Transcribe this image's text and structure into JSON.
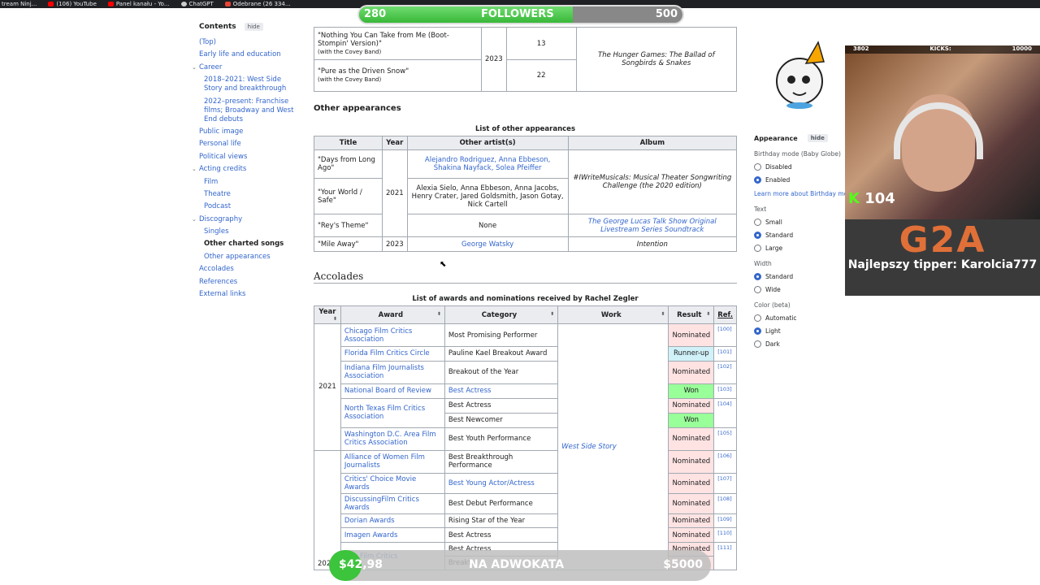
{
  "bookmarks": [
    "tream Ninj...",
    "(106) YouTube",
    "Panel kanału - Yo...",
    "ChatGPT",
    "Odebrane (26 334..."
  ],
  "followers": {
    "current": "280",
    "label": "FOLLOWERS",
    "goal": "500"
  },
  "toc": {
    "title": "Contents",
    "hide": "hide",
    "items": [
      {
        "label": "(Top)"
      },
      {
        "label": "Early life and education"
      },
      {
        "label": "Career",
        "chev": "v"
      },
      {
        "label": "2018–2021: West Side Story and breakthrough",
        "l2": true
      },
      {
        "label": "2022–present: Franchise films; Broadway and West End debuts",
        "l2": true
      },
      {
        "label": "Public image"
      },
      {
        "label": "Personal life"
      },
      {
        "label": "Political views"
      },
      {
        "label": "Acting credits",
        "chev": "v"
      },
      {
        "label": "Film",
        "l2": true
      },
      {
        "label": "Theatre",
        "l2": true
      },
      {
        "label": "Podcast",
        "l2": true
      },
      {
        "label": "Discography",
        "chev": "v"
      },
      {
        "label": "Singles",
        "l2": true
      },
      {
        "label": "Other charted songs",
        "l2": true,
        "current": true
      },
      {
        "label": "Other appearances",
        "l2": true
      },
      {
        "label": "Accolades"
      },
      {
        "label": "References"
      },
      {
        "label": "External links"
      }
    ]
  },
  "top_table": {
    "rows": [
      {
        "title": "\"Nothing You Can Take from Me (Boot-Stompin' Version)\"",
        "note": "(with the Covey Band)",
        "peak": "13"
      },
      {
        "title": "\"Pure as the Driven Snow\"",
        "note": "(with the Covey Band)",
        "peak": "22"
      }
    ],
    "year": "2023",
    "album": "The Hunger Games: The Ballad of Songbirds & Snakes"
  },
  "other": {
    "heading": "Other appearances",
    "caption": "List of other appearances",
    "headers": [
      "Title",
      "Year",
      "Other artist(s)",
      "Album"
    ],
    "rows": [
      {
        "title": "\"Days from Long Ago\"",
        "artists": "Alejandro Rodriguez, Anna Ebbeson, Shakina Nayfack, Solea Pfeiffer"
      },
      {
        "title": "\"Your World / Safe\"",
        "artists": "Alexia Sielo, Anna Ebbeson, Anna Jacobs, Henry Crater, Jared Goldsmith, Jason Gotay, Nick Cartell"
      },
      {
        "title": "\"Rey's Theme\"",
        "artists": "None"
      },
      {
        "title": "\"Mile Away\"",
        "artists": "George Watsky"
      }
    ],
    "year1": "2021",
    "year2": "2023",
    "album1": "#IWriteMusicals: Musical Theater Songwriting Challenge (the 2020 edition)",
    "album2": "The George Lucas Talk Show Original Livestream Series Soundtrack",
    "album3": "Intention"
  },
  "accolades": {
    "heading": "Accolades",
    "caption": "List of awards and nominations received by Rachel Zegler",
    "headers": [
      "Year",
      "Award",
      "Category",
      "Work",
      "Result",
      "Ref."
    ],
    "year2021": "2021",
    "year2022": "202",
    "work": "West Side Story",
    "rows": [
      {
        "award": "Chicago Film Critics Association",
        "cat": "Most Promising Performer",
        "res": "Nominated",
        "ref": "[100]"
      },
      {
        "award": "Florida Film Critics Circle",
        "cat": "Pauline Kael Breakout Award",
        "res": "Runner-up",
        "ref": "[101]"
      },
      {
        "award": "Indiana Film Journalists Association",
        "cat": "Breakout of the Year",
        "res": "Nominated",
        "ref": "[102]"
      },
      {
        "award": "National Board of Review",
        "cat": "Best Actress",
        "res": "Won",
        "ref": "[103]"
      },
      {
        "award": "North Texas Film Critics Association",
        "cat": "Best Actress",
        "res": "Nominated",
        "ref": "[104]",
        "cat2": "Best Newcomer",
        "res2": "Won"
      },
      {
        "award": "Washington D.C. Area Film Critics Association",
        "cat": "Best Youth Performance",
        "res": "Nominated",
        "ref": "[105]"
      },
      {
        "award": "Alliance of Women Film Journalists",
        "cat": "Best Breakthrough Performance",
        "res": "Nominated",
        "ref": "[106]"
      },
      {
        "award": "Critics' Choice Movie Awards",
        "cat": "Best Young Actor/Actress",
        "res": "Nominated",
        "ref": "[107]"
      },
      {
        "award": "DiscussingFilm Critics Awards",
        "cat": "Best Debut Performance",
        "res": "Nominated",
        "ref": "[108]"
      },
      {
        "award": "Dorian Awards",
        "cat": "Rising Star of the Year",
        "res": "Nominated",
        "ref": "[109]"
      },
      {
        "award": "Imagen Awards",
        "cat": "Best Actress",
        "res": "Nominated",
        "ref": "[110]"
      },
      {
        "award": "rgia Film Critics",
        "cat": "Best Actress",
        "res": "Nominated",
        "ref": "[111]",
        "cat2": "Breakt"
      }
    ]
  },
  "appearance": {
    "title": "Appearance",
    "hide": "hide",
    "birthday_label": "Birthday mode (Baby Globe)",
    "birthday": [
      "Disabled",
      "Enabled"
    ],
    "learn": "Learn more about Birthday mode",
    "text_label": "Text",
    "text": [
      "Small",
      "Standard",
      "Large"
    ],
    "width_label": "Width",
    "width": [
      "Standard",
      "Wide"
    ],
    "color_label": "Color (beta)",
    "color": [
      "Automatic",
      "Light",
      "Dark"
    ]
  },
  "cam": {
    "left_count": "3802",
    "kicks": "KICKS:",
    "right_count": "10000",
    "kick_value": "104",
    "sponsor": "G2A",
    "tipper": "Najlepszy tipper: Karolcia777"
  },
  "donate": {
    "current": "$42,98",
    "label": "NA ADWOKATA",
    "goal": "$5000"
  }
}
